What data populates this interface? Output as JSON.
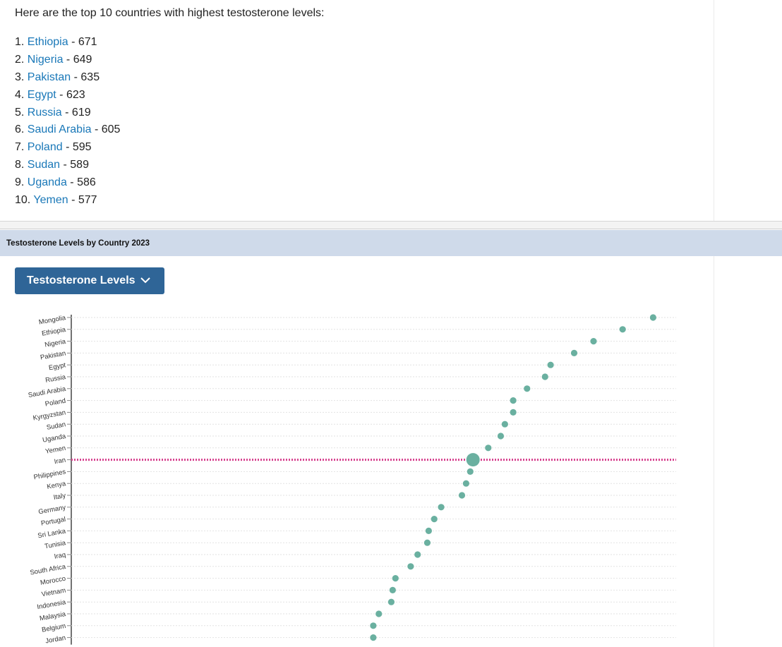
{
  "intro_text": "Here are the top 10 countries with highest testosterone levels:",
  "top_list": [
    {
      "rank": "1.",
      "country": "Ethiopia",
      "value": "671"
    },
    {
      "rank": "2.",
      "country": "Nigeria",
      "value": "649"
    },
    {
      "rank": "3.",
      "country": "Pakistan",
      "value": "635"
    },
    {
      "rank": "4.",
      "country": "Egypt",
      "value": "623"
    },
    {
      "rank": "5.",
      "country": "Russia",
      "value": "619"
    },
    {
      "rank": "6.",
      "country": "Saudi Arabia",
      "value": "605"
    },
    {
      "rank": "7.",
      "country": "Poland",
      "value": "595"
    },
    {
      "rank": "8.",
      "country": "Sudan",
      "value": "589"
    },
    {
      "rank": "9.",
      "country": "Uganda",
      "value": "586"
    },
    {
      "rank": "10.",
      "country": "Yemen",
      "value": "577"
    }
  ],
  "chart_section": {
    "title": "Testosterone Levels by Country 2023",
    "dropdown_label": "Testosterone Levels"
  },
  "colors": {
    "link": "#1a78b8",
    "header_band": "#cfdaea",
    "button": "#2f6597",
    "dot": "#6ab0a0",
    "highlight_line": "#d63d8c"
  },
  "icons": {
    "dropdown": "chevron-down-icon"
  },
  "chart_data": {
    "type": "scatter",
    "title": "Testosterone Levels by Country 2023",
    "categories": [
      "Mongolia",
      "Ethiopia",
      "Nigeria",
      "Pakistan",
      "Egypt",
      "Russia",
      "Saudi Arabia",
      "Poland",
      "Kyrgyzstan",
      "Sudan",
      "Uganda",
      "Yemen",
      "Iran",
      "Philippines",
      "Kenya",
      "Italy",
      "Germany",
      "Portugal",
      "Sri Lanka",
      "Tunisia",
      "Iraq",
      "South Africa",
      "Morocco",
      "Vietnam",
      "Indonesia",
      "Malaysia",
      "Belgium",
      "Jordan"
    ],
    "values": [
      720,
      698,
      677,
      663,
      646,
      642,
      629,
      619,
      619,
      613,
      610,
      601,
      590,
      588,
      585,
      582,
      567,
      562,
      558,
      557,
      550,
      545,
      534,
      532,
      531,
      522,
      518,
      518
    ],
    "highlight_category": "Iran",
    "xlim": [
      300,
      730
    ],
    "grid": true,
    "legend": "none"
  }
}
